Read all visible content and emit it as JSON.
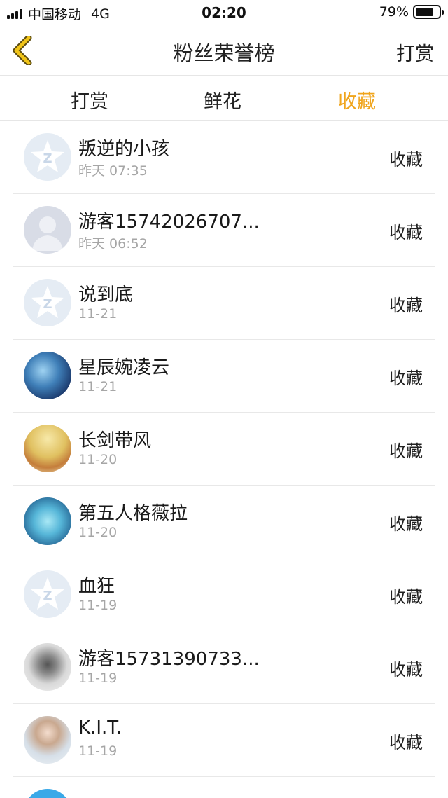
{
  "status_bar": {
    "carrier": "中国移动",
    "network": "4G",
    "time": "02:20",
    "battery": "79%",
    "battery_level": 0.79
  },
  "nav": {
    "title": "粉丝荣誉榜",
    "right_action": "打赏",
    "back_icon": "chevron-left-icon",
    "accent_color": "#f0c419"
  },
  "tabs": [
    {
      "label": "打赏",
      "active": false
    },
    {
      "label": "鲜花",
      "active": false
    },
    {
      "label": "收藏",
      "active": true
    }
  ],
  "tab_active_color": "#f0a51c",
  "fans": [
    {
      "name": "叛逆的小孩",
      "time": "昨天 07:35",
      "action": "收藏",
      "avatar": "qzone-star-avatar"
    },
    {
      "name": "游客15742026707...",
      "time": "昨天 06:52",
      "action": "收藏",
      "avatar": "guest-silhouette-avatar"
    },
    {
      "name": "说到底",
      "time": "11-21",
      "action": "收藏",
      "avatar": "qzone-star-avatar"
    },
    {
      "name": "星辰婉凌云",
      "time": "11-21",
      "action": "收藏",
      "avatar": "anime-avatar"
    },
    {
      "name": "长剑带风",
      "time": "11-20",
      "action": "收藏",
      "avatar": "hair-avatar"
    },
    {
      "name": "第五人格薇拉",
      "time": "11-20",
      "action": "收藏",
      "avatar": "anime-avatar"
    },
    {
      "name": "血狂",
      "time": "11-19",
      "action": "收藏",
      "avatar": "qzone-star-avatar"
    },
    {
      "name": "游客15731390733...",
      "time": "11-19",
      "action": "收藏",
      "avatar": "sketch-avatar"
    },
    {
      "name": "K.I.T.",
      "time": "11-19",
      "action": "收藏",
      "avatar": "photo-avatar"
    }
  ]
}
